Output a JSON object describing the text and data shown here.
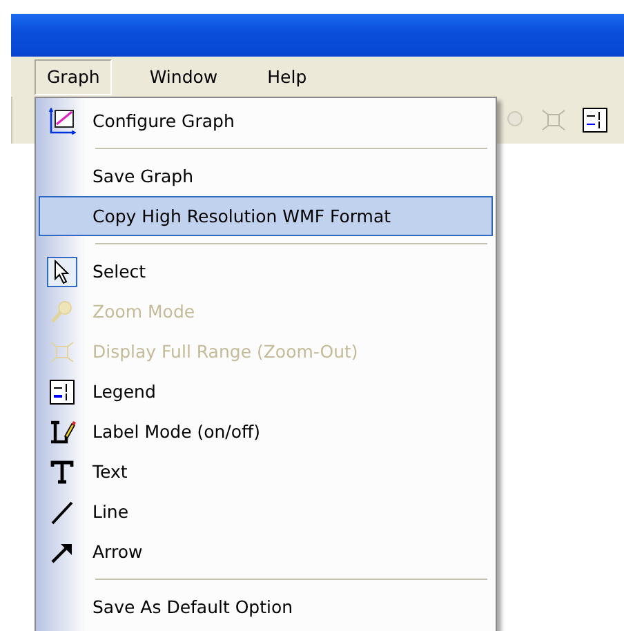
{
  "menubar": [
    {
      "label": "Graph",
      "selected": true
    },
    {
      "label": "Window",
      "selected": false
    },
    {
      "label": "Help",
      "selected": false
    }
  ],
  "menu": {
    "items": [
      {
        "kind": "command",
        "label": "Configure Graph",
        "disabled": false,
        "selected": false,
        "checked": false
      },
      {
        "kind": "separator"
      },
      {
        "kind": "command",
        "label": "Save Graph",
        "disabled": false,
        "selected": false,
        "checked": false
      },
      {
        "kind": "command",
        "label": "Copy High Resolution WMF Format",
        "disabled": false,
        "selected": true,
        "checked": false
      },
      {
        "kind": "separator"
      },
      {
        "kind": "command",
        "label": "Select",
        "disabled": false,
        "selected": false,
        "checked": true
      },
      {
        "kind": "command",
        "label": "Zoom Mode",
        "disabled": true,
        "selected": false,
        "checked": false
      },
      {
        "kind": "command",
        "label": "Display Full Range (Zoom-Out)",
        "disabled": true,
        "selected": false,
        "checked": false
      },
      {
        "kind": "command",
        "label": "Legend",
        "disabled": false,
        "selected": false,
        "checked": false
      },
      {
        "kind": "command",
        "label": "Label Mode (on/off)",
        "disabled": false,
        "selected": false,
        "checked": false
      },
      {
        "kind": "command",
        "label": "Text",
        "disabled": false,
        "selected": false,
        "checked": false
      },
      {
        "kind": "command",
        "label": "Line",
        "disabled": false,
        "selected": false,
        "checked": false
      },
      {
        "kind": "command",
        "label": "Arrow",
        "disabled": false,
        "selected": false,
        "checked": false
      },
      {
        "kind": "separator"
      },
      {
        "kind": "command",
        "label": "Save As Default Option",
        "disabled": false,
        "selected": false,
        "checked": false
      }
    ]
  }
}
